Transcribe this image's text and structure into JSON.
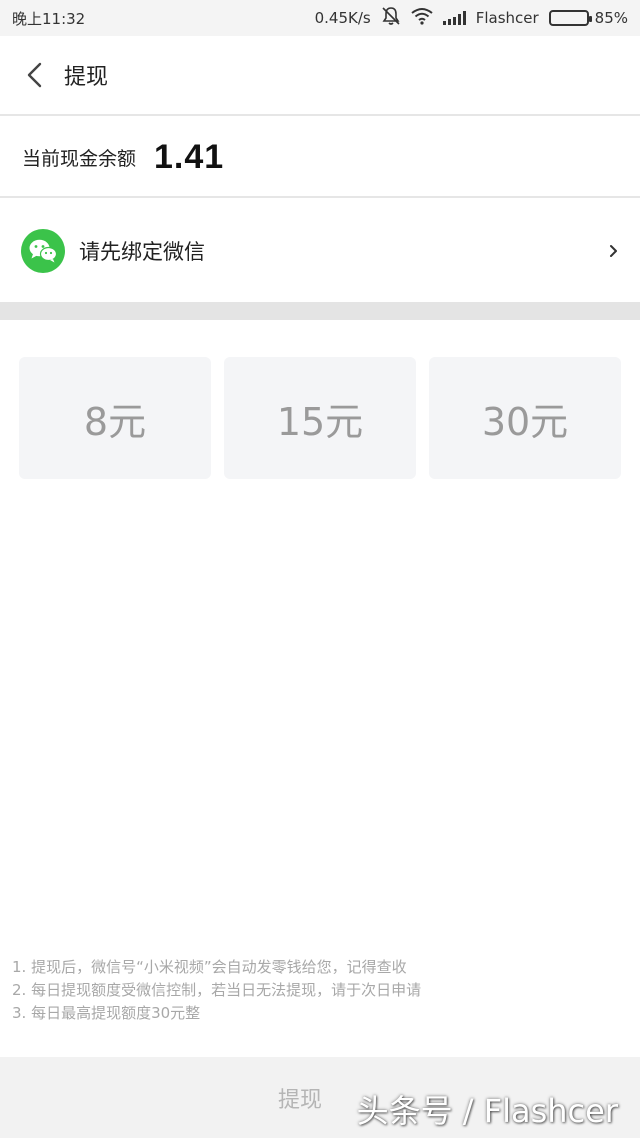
{
  "status_bar": {
    "time": "晚上11:32",
    "network_speed": "0.45K/s",
    "carrier": "Flashcer",
    "battery": "85%",
    "battery_level": 0.85
  },
  "header": {
    "title": "提现"
  },
  "balance": {
    "label": "当前现金余额",
    "value": "1.41"
  },
  "wechat": {
    "label": "请先绑定微信",
    "icon_color": "#3bc34a"
  },
  "amount_options": [
    "8元",
    "15元",
    "30元"
  ],
  "notes": [
    "1. 提现后，微信号“小米视频”会自动发零钱给您，记得查收",
    "2. 每日提现额度受微信控制，若当日无法提现，请于次日申请",
    "3. 每日最高提现额度30元整"
  ],
  "footer": {
    "submit_label": "提现",
    "watermark": "头条号 / Flashcer"
  }
}
